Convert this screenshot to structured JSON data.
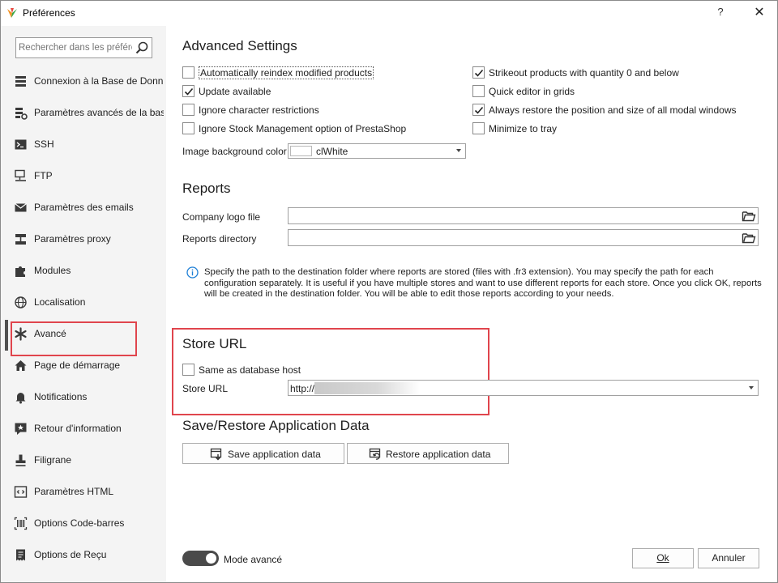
{
  "window": {
    "title": "Préférences",
    "help_label": "?",
    "close_label": "✕"
  },
  "sidebar": {
    "search_placeholder": "Rechercher dans les préférences",
    "items": [
      {
        "label": "Connexion à la Base de Données",
        "icon": "database-icon"
      },
      {
        "label": "Paramètres avancés de la base de données",
        "icon": "database-settings-icon"
      },
      {
        "label": "SSH",
        "icon": "terminal-icon"
      },
      {
        "label": "FTP",
        "icon": "ftp-icon"
      },
      {
        "label": "Paramètres des emails",
        "icon": "envelope-icon"
      },
      {
        "label": "Paramètres proxy",
        "icon": "proxy-icon"
      },
      {
        "label": "Modules",
        "icon": "puzzle-icon"
      },
      {
        "label": "Localisation",
        "icon": "globe-icon"
      },
      {
        "label": "Avancé",
        "icon": "asterisk-icon",
        "active": true
      },
      {
        "label": "Page de démarrage",
        "icon": "home-icon"
      },
      {
        "label": "Notifications",
        "icon": "bell-icon"
      },
      {
        "label": "Retour d'information",
        "icon": "feedback-icon"
      },
      {
        "label": "Filigrane",
        "icon": "stamp-icon"
      },
      {
        "label": "Paramètres HTML",
        "icon": "code-icon"
      },
      {
        "label": "Options Code-barres",
        "icon": "barcode-icon"
      },
      {
        "label": "Options de Reçu",
        "icon": "receipt-icon"
      }
    ]
  },
  "advanced": {
    "title": "Advanced Settings",
    "checkboxes_left": [
      {
        "label": "Automatically reindex modified products",
        "checked": false
      },
      {
        "label": "Update available",
        "checked": true
      },
      {
        "label": "Ignore character restrictions",
        "checked": false
      },
      {
        "label": "Ignore Stock Management option of PrestaShop",
        "checked": false
      }
    ],
    "checkboxes_right": [
      {
        "label": "Strikeout products with quantity 0 and below",
        "checked": true
      },
      {
        "label": "Quick editor in grids",
        "checked": false
      },
      {
        "label": "Always restore the position and size of all modal windows",
        "checked": true
      },
      {
        "label": "Minimize to tray",
        "checked": false
      }
    ],
    "image_bg_label": "Image background color",
    "image_bg_value": "clWhite",
    "image_bg_color": "#ffffff"
  },
  "reports": {
    "title": "Reports",
    "logo_label": "Company logo file",
    "logo_value": "",
    "dir_label": "Reports directory",
    "dir_value": "",
    "info": "Specify the path to the destination folder where reports are stored (files with .fr3 extension). You may specify the path for each configuration separately. It is useful if you have multiple stores and want to use different reports for each store. Once you click OK, reports will be created in the destination folder. You will be able to edit those reports according to your needs."
  },
  "store_url": {
    "title": "Store URL",
    "same_host_label": "Same as database host",
    "same_host_checked": false,
    "url_label": "Store URL",
    "url_value": "http://"
  },
  "save_restore": {
    "title": "Save/Restore Application Data",
    "save_label": "Save application data",
    "restore_label": "Restore application data"
  },
  "footer": {
    "mode_label": "Mode avancé",
    "mode_on": true,
    "ok_label": "Ok",
    "cancel_label": "Annuler"
  },
  "colors": {
    "highlight": "#e0454d",
    "active_bar": "#505050",
    "info_blue": "#1e7fd6"
  }
}
